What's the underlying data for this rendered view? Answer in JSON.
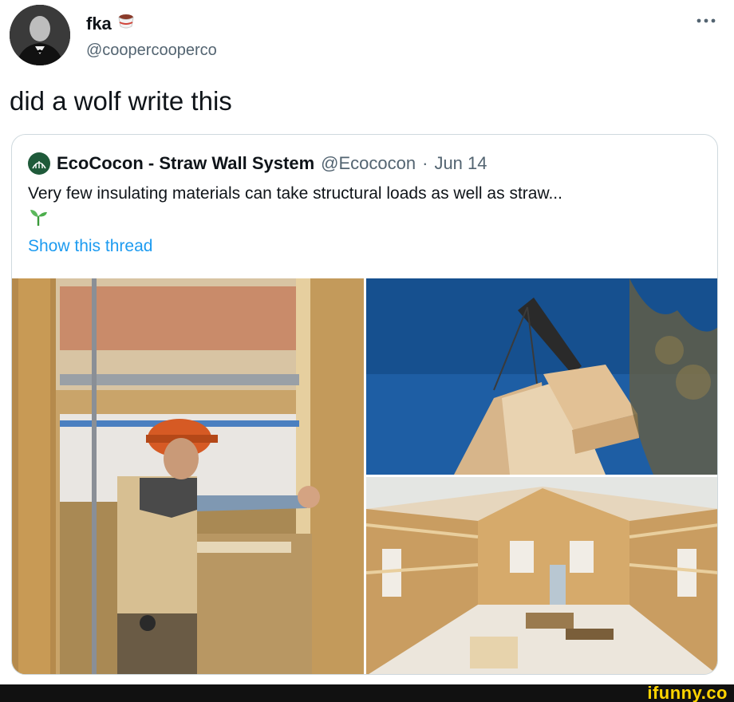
{
  "tweet": {
    "display_name": "fka",
    "name_emoji": "coffee-cup-icon",
    "handle": "@coopercooperco",
    "text": "did a wolf write this"
  },
  "quote": {
    "display_name": "EcoCocon - Straw Wall System",
    "handle": "@Ecococon",
    "separator": "·",
    "date": "Jun 14",
    "text": "Very few insulating materials can take structural loads as well as straw...",
    "emoji": "seedling-icon",
    "show_thread_label": "Show this thread"
  },
  "watermark": {
    "text": "ifunny.co",
    "color": "#ffd400"
  },
  "colors": {
    "link": "#1d9bf0",
    "secondary_text": "#536471",
    "border": "#cfd9de"
  }
}
